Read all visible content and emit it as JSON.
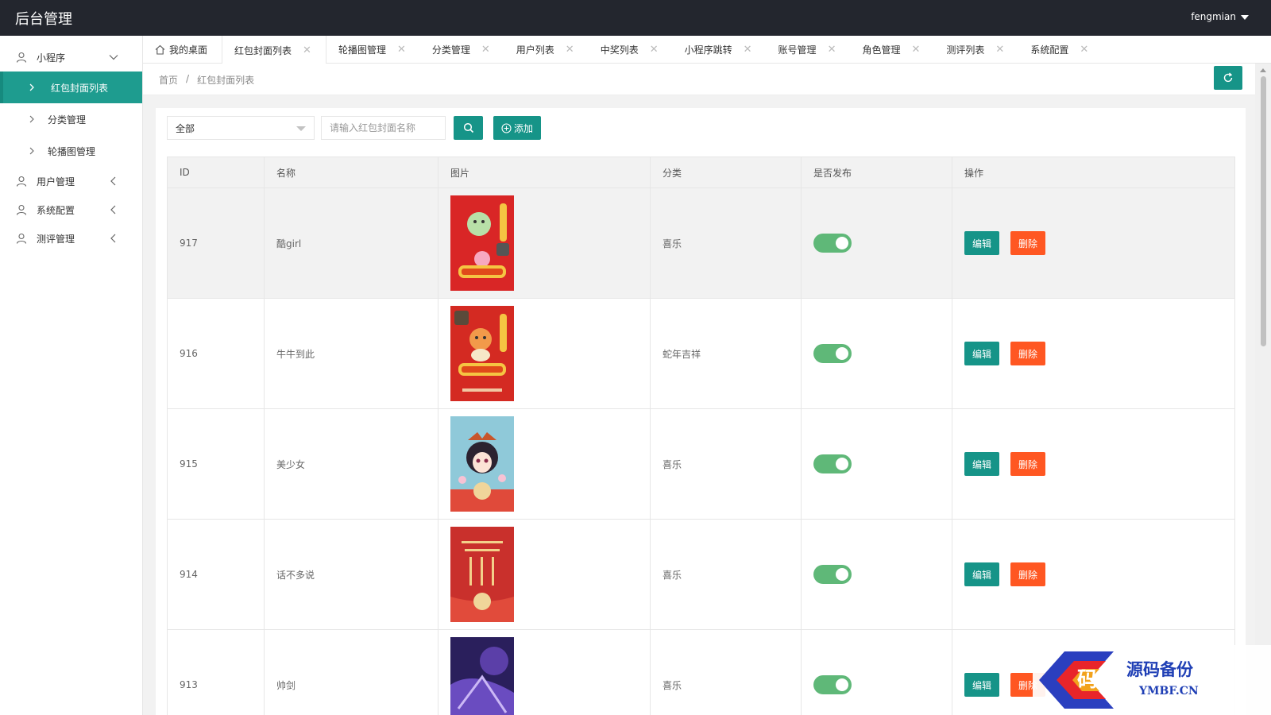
{
  "app": {
    "title": "后台管理",
    "username": "fengmian"
  },
  "sidebar": {
    "groups": [
      {
        "label": "小程序",
        "subitems": [
          "红包封面列表",
          "分类管理",
          "轮播图管理"
        ]
      },
      {
        "label": "用户管理"
      },
      {
        "label": "系统配置"
      },
      {
        "label": "测评管理"
      }
    ]
  },
  "tabs": [
    "我的桌面",
    "红包封面列表",
    "轮播图管理",
    "分类管理",
    "用户列表",
    "中奖列表",
    "小程序跳转",
    "账号管理",
    "角色管理",
    "测评列表",
    "系统配置"
  ],
  "breadcrumb": [
    "首页",
    "/",
    "红包封面列表"
  ],
  "filters": {
    "category_selected": "全部",
    "search_placeholder": "请输入红包封面名称",
    "add_label": "添加"
  },
  "table": {
    "headers": [
      "ID",
      "名称",
      "图片",
      "分类",
      "是否发布",
      "操作"
    ],
    "rows": [
      {
        "id": "917",
        "name": "酷girl",
        "category": "喜乐",
        "published": true
      },
      {
        "id": "916",
        "name": "牛牛到此",
        "category": "蛇年吉祥",
        "published": true
      },
      {
        "id": "915",
        "name": "美少女",
        "category": "喜乐",
        "published": true
      },
      {
        "id": "914",
        "name": "话不多说",
        "category": "喜乐",
        "published": true
      },
      {
        "id": "913",
        "name": "帅剑",
        "category": "喜乐",
        "published": true
      }
    ],
    "edit_label": "编辑",
    "delete_label": "删除"
  },
  "watermark": {
    "text": "源码备份",
    "domain": "YMBF.CN",
    "glyph": "码"
  },
  "colors": {
    "header": "#23262e",
    "primary": "#169488",
    "danger": "#ff5722",
    "switch_on": "#5fb878"
  }
}
